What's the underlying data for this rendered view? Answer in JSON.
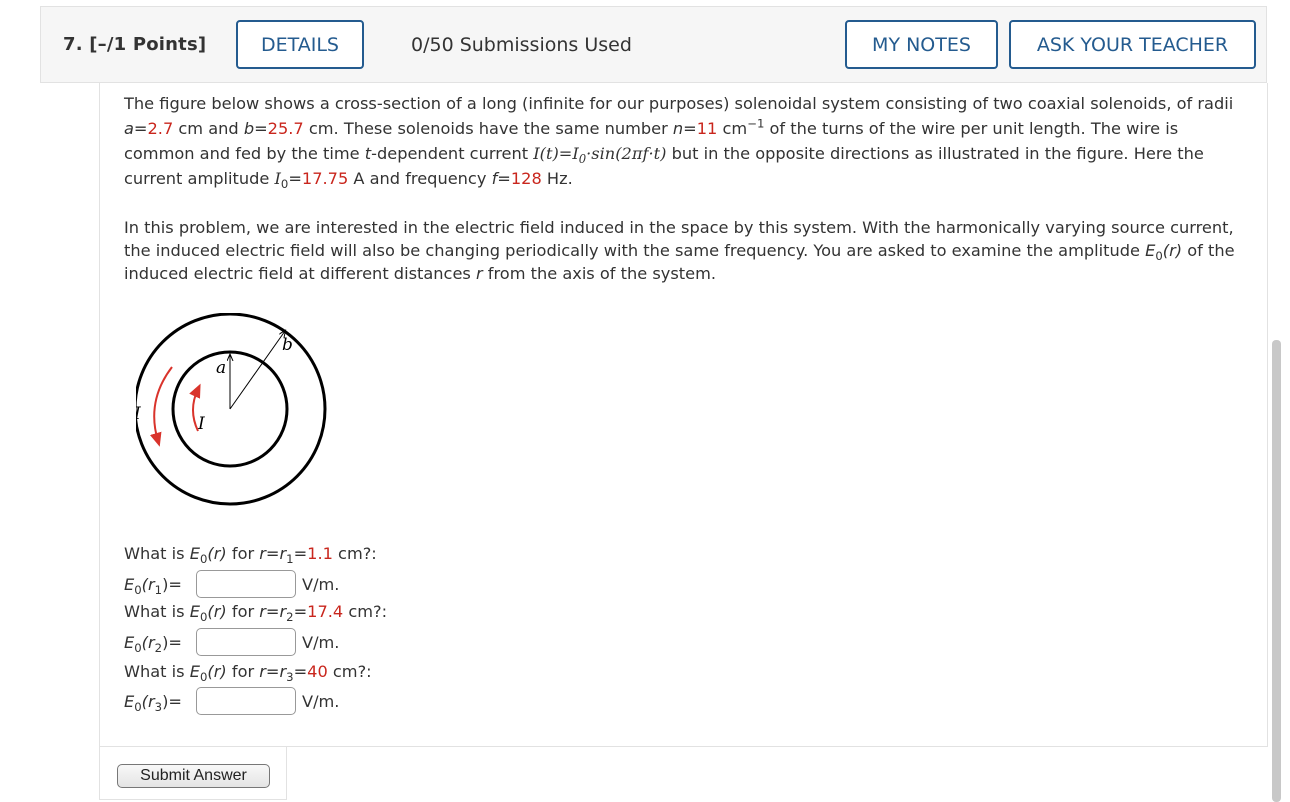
{
  "header": {
    "question_number": "7. [–/1 Points]",
    "details_label": "DETAILS",
    "submissions": "0/50 Submissions Used",
    "my_notes_label": "MY NOTES",
    "ask_teacher_label": "ASK YOUR TEACHER"
  },
  "problem": {
    "p1": {
      "t1": "The figure below shows a cross-section of a long (infinite for our purposes) solenoidal system consisting of two coaxial solenoids, of radii ",
      "a_var": "a",
      "eq1": "=",
      "a_val": "2.7",
      "t2": " cm and ",
      "b_var": "b",
      "eq2": "=",
      "b_val": "25.7",
      "t3": " cm. These solenoids have the same number ",
      "n_var": "n",
      "eq3": "=",
      "n_val": "11",
      "t4": " cm",
      "t4_sup": "−1",
      "t5": " of the turns of the wire per unit length. The wire is common and fed by the time ",
      "t_var": "t",
      "t6": "-dependent current ",
      "current_expr": "I(t)=I",
      "current_sub": "0",
      "current_expr2": "·sin(2πf·t)",
      "t7": " but in the opposite directions as illustrated in the figure. Here the current amplitude ",
      "i0": "I",
      "i0_sub": "0",
      "eq4": "=",
      "i0_val": "17.75",
      "t8": " A and frequency ",
      "f_var": "f",
      "eq5": "=",
      "f_val": "128",
      "t9": " Hz."
    },
    "p2": {
      "t1": "In this problem, we are interested in the electric field induced in the space by this system. With the harmonically varying source current, the induced electric field will also be changing periodically with the same frequency. You are asked to examine the amplitude ",
      "e0": "E",
      "e0_sub": "0",
      "e0_arg": "(r)",
      "t2": " of the induced electric field at different distances ",
      "r_var": "r",
      "t3": " from the axis of the system."
    }
  },
  "figure": {
    "label_a": "a",
    "label_b": "b",
    "label_I_outer": "I",
    "label_I_inner": "I",
    "arrow_color": "#d9332b"
  },
  "questions": [
    {
      "prefix": "What is ",
      "e": "E",
      "e_sub": "0",
      "e_arg": "(r)",
      "mid": " for ",
      "r_expr": "r=r",
      "r_sub": "1",
      "eq": "=",
      "value": "1.1",
      "unit": " cm?:",
      "ans_label_e": "E",
      "ans_label_sub": "0",
      "ans_label_arg": "(r",
      "ans_label_rsub": "1",
      "ans_label_end": ")=",
      "ans_unit": "V/m."
    },
    {
      "prefix": "What is ",
      "e": "E",
      "e_sub": "0",
      "e_arg": "(r)",
      "mid": " for ",
      "r_expr": "r=r",
      "r_sub": "2",
      "eq": "=",
      "value": "17.4",
      "unit": " cm?:",
      "ans_label_e": "E",
      "ans_label_sub": "0",
      "ans_label_arg": "(r",
      "ans_label_rsub": "2",
      "ans_label_end": ")=",
      "ans_unit": "V/m."
    },
    {
      "prefix": "What is ",
      "e": "E",
      "e_sub": "0",
      "e_arg": "(r)",
      "mid": " for ",
      "r_expr": "r=r",
      "r_sub": "3",
      "eq": "=",
      "value": "40",
      "unit": " cm?:",
      "ans_label_e": "E",
      "ans_label_sub": "0",
      "ans_label_arg": "(r",
      "ans_label_rsub": "3",
      "ans_label_end": ")=",
      "ans_unit": "V/m."
    }
  ],
  "submit_label": "Submit Answer"
}
